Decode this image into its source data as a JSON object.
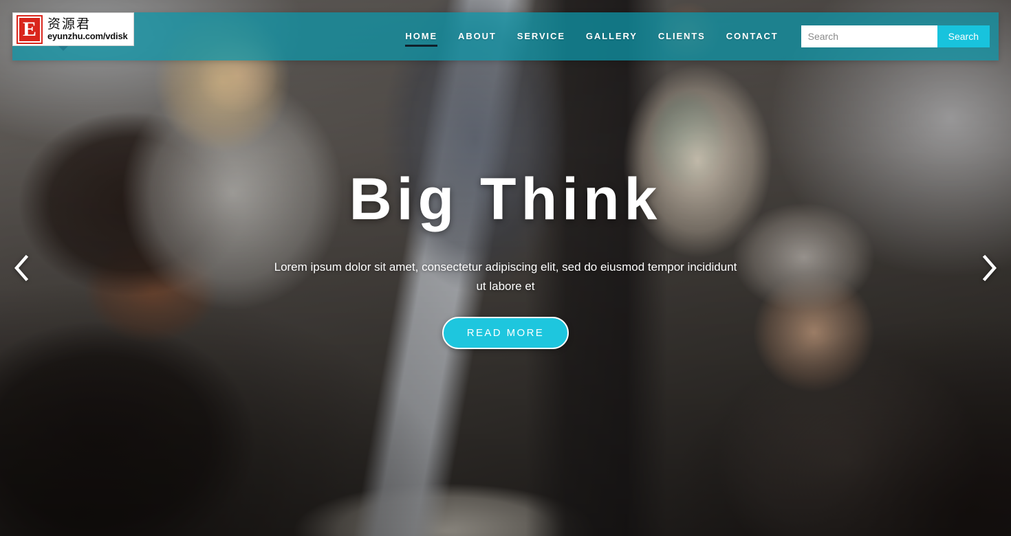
{
  "watermark": {
    "mark_letter": "E",
    "brand_cn": "资源君",
    "brand_url": "eyunzhu.com/vdisk"
  },
  "header": {
    "background_color": "#0e96a8",
    "nav": [
      {
        "label": "HOME",
        "active": true
      },
      {
        "label": "ABOUT",
        "active": false
      },
      {
        "label": "SERVICE",
        "active": false
      },
      {
        "label": "GALLERY",
        "active": false
      },
      {
        "label": "CLIENTS",
        "active": false
      },
      {
        "label": "CONTACT",
        "active": false
      }
    ],
    "search": {
      "placeholder": "Search",
      "value": "",
      "button_label": "Search",
      "button_color": "#18c3dd"
    }
  },
  "hero": {
    "title": "Big Think",
    "subtitle": "Lorem ipsum dolor sit amet, consectetur adipiscing elit, sed do eiusmod tempor incididunt ut labore et",
    "cta_label": "READ MORE",
    "cta_color": "#1ec6de",
    "prev_icon": "chevron-left-icon",
    "next_icon": "chevron-right-icon"
  }
}
